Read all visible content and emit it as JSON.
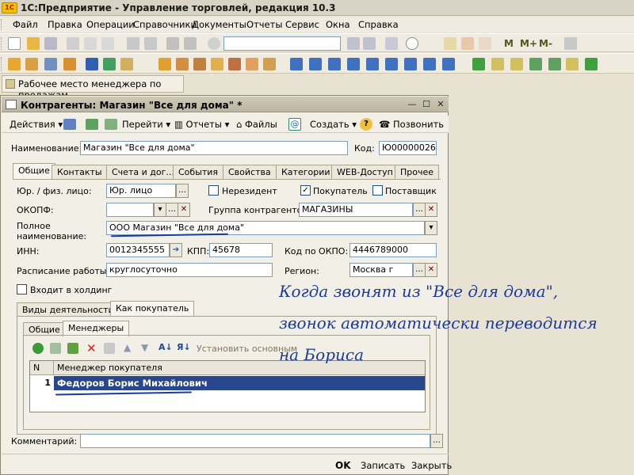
{
  "app": {
    "title": "1С:Предприятие - Управление торговлей, редакция 10.3",
    "logo": "1С"
  },
  "menu": [
    "Файл",
    "Правка",
    "Операции",
    "Справочники",
    "Документы",
    "Отчеты",
    "Сервис",
    "Окна",
    "Справка"
  ],
  "toolbar2": {
    "mem_buttons": [
      "M",
      "M+",
      "M-"
    ]
  },
  "panel": {
    "label": "Рабочее место менеджера по продажам"
  },
  "window": {
    "title": "Контрагенты: Магазин \"Все для дома\" *"
  },
  "form_toolbar": {
    "actions": "Действия",
    "goto": "Перейти",
    "reports": "Отчеты",
    "files": "Файлы",
    "create": "Создать",
    "call": "Позвонить"
  },
  "form": {
    "name_label": "Наименование:",
    "name_value": "Магазин \"Все для дома\"",
    "code_label": "Код:",
    "code_value": "Ю00000026",
    "tabs": [
      "Общие",
      "Контакты",
      "Счета и дог...",
      "События",
      "Свойства",
      "Категории",
      "WEB-Доступ",
      "Прочее"
    ],
    "legal_label": "Юр. / физ. лицо:",
    "legal_value": "Юр. лицо",
    "nonresident": "Нерезидент",
    "buyer": "Покупатель",
    "supplier": "Поставщик",
    "okopf_label": "ОКОПФ:",
    "okopf_value": "",
    "group_label": "Группа контрагентов:",
    "group_value": "МАГАЗИНЫ",
    "fullname_label1": "Полное",
    "fullname_label2": "наименование:",
    "fullname_value": "ООО Магазин \"Все для дома\"",
    "inn_label": "ИНН:",
    "inn_value": "0012345555",
    "kpp_label": "КПП:",
    "kpp_value": "45678",
    "okpo_label": "Код по ОКПО:",
    "okpo_value": "4446789000",
    "schedule_label": "Расписание работы:",
    "schedule_value": "круглосуточно",
    "region_label": "Регион:",
    "region_value": "Москва г",
    "holding": "Входит в холдинг",
    "subtabs": [
      "Виды деятельности",
      "Как покупатель"
    ],
    "innertabs": [
      "Общие",
      "Менеджеры"
    ],
    "set_main": "Установить основным",
    "col_n": "N",
    "col_manager": "Менеджер покупателя",
    "row_n": "1",
    "row_manager": "Федоров Борис Михайлович",
    "comment_label": "Комментарий:",
    "comment_value": ""
  },
  "bottom": {
    "ok": "OK",
    "save": "Записать",
    "close": "Закрыть"
  },
  "annotation": {
    "line1": "Когда звонят из \"Все для дома\",",
    "line2": "звонок автоматически переводится",
    "line3": "на Бориса"
  }
}
